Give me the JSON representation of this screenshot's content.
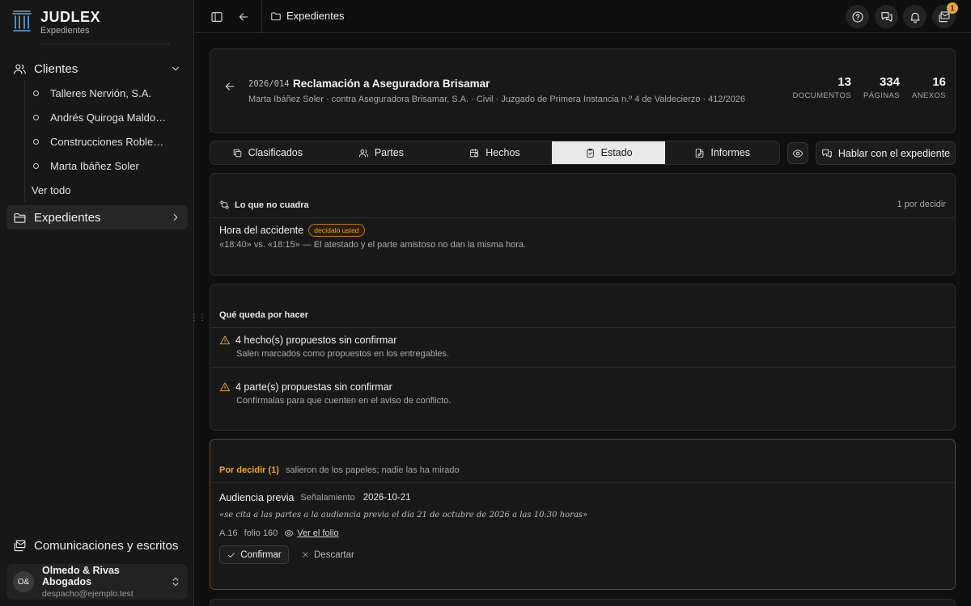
{
  "brand": {
    "name": "JUDLEX",
    "subtitle": "Expedientes"
  },
  "sidebar": {
    "clients_label": "Clientes",
    "clients": [
      "Talleres Nervión, S.A.",
      "Andrés Quiroga Maldonado",
      "Construcciones Robledal, S.L.",
      "Marta Ibáñez Soler"
    ],
    "see_all": "Ver todo",
    "expedientes_label": "Expedientes",
    "comunicaciones_label": "Comunicaciones y escritos",
    "account": {
      "initials": "O&",
      "name": "Olmedo & Rivas Abogados",
      "email": "despacho@ejemplo.test"
    }
  },
  "topbar": {
    "breadcrumb": "Expedientes",
    "notifications_count": "1"
  },
  "case": {
    "code": "2026/014",
    "title": "Reclamación a Aseguradora Brisamar",
    "meta": "Marta Ibáñez Soler · contra Aseguradora Brisamar, S.A. · Civil · Juzgado de Primera Instancia n.º 4 de Valdecierzo · 412/2026",
    "stats": [
      {
        "value": "13",
        "label": "DOCUMENTOS"
      },
      {
        "value": "334",
        "label": "PÁGINAS"
      },
      {
        "value": "16",
        "label": "ANEXOS"
      }
    ]
  },
  "tabs": [
    "Clasificados",
    "Partes",
    "Hechos",
    "Estado",
    "Informes"
  ],
  "active_tab": "Estado",
  "chat_button": "Hablar con el expediente",
  "issues": {
    "title": "Lo que no cuadra",
    "counter": "1 por decidir",
    "item_title": "Hora del accidente",
    "item_badge": "decídalo usted",
    "item_detail": "«18:40» vs. «18:15» — El atestado y el parte amistoso no dan la misma hora."
  },
  "todo": {
    "title": "Qué queda por hacer",
    "items": [
      {
        "title": "4 hecho(s) propuestos sin confirmar",
        "detail": "Salen marcados como propuestos en los entregables."
      },
      {
        "title": "4 parte(s) propuestas sin confirmar",
        "detail": "Confírmalas para que cuenten en el aviso de conflicto."
      }
    ]
  },
  "decide": {
    "title": "Por decidir (1)",
    "subtitle": "salieron de los papeles; nadie las ha mirado",
    "item_name": "Audiencia previa",
    "item_type": "Señalamiento",
    "item_date": "2026-10-21",
    "quote": "«se cita a las partes a la audiencia previa el día 21 de octubre de 2026 a las 10:30 horas»",
    "annex": "A.16",
    "folio": "folio 160",
    "folio_link": "Ver el folio",
    "confirm": "Confirmar",
    "discard": "Descartar"
  },
  "colors": {
    "accent_warning": "#e8a63a",
    "brand_blue": "#6fa4e0",
    "active_tab_bg": "#e9e9e9"
  }
}
